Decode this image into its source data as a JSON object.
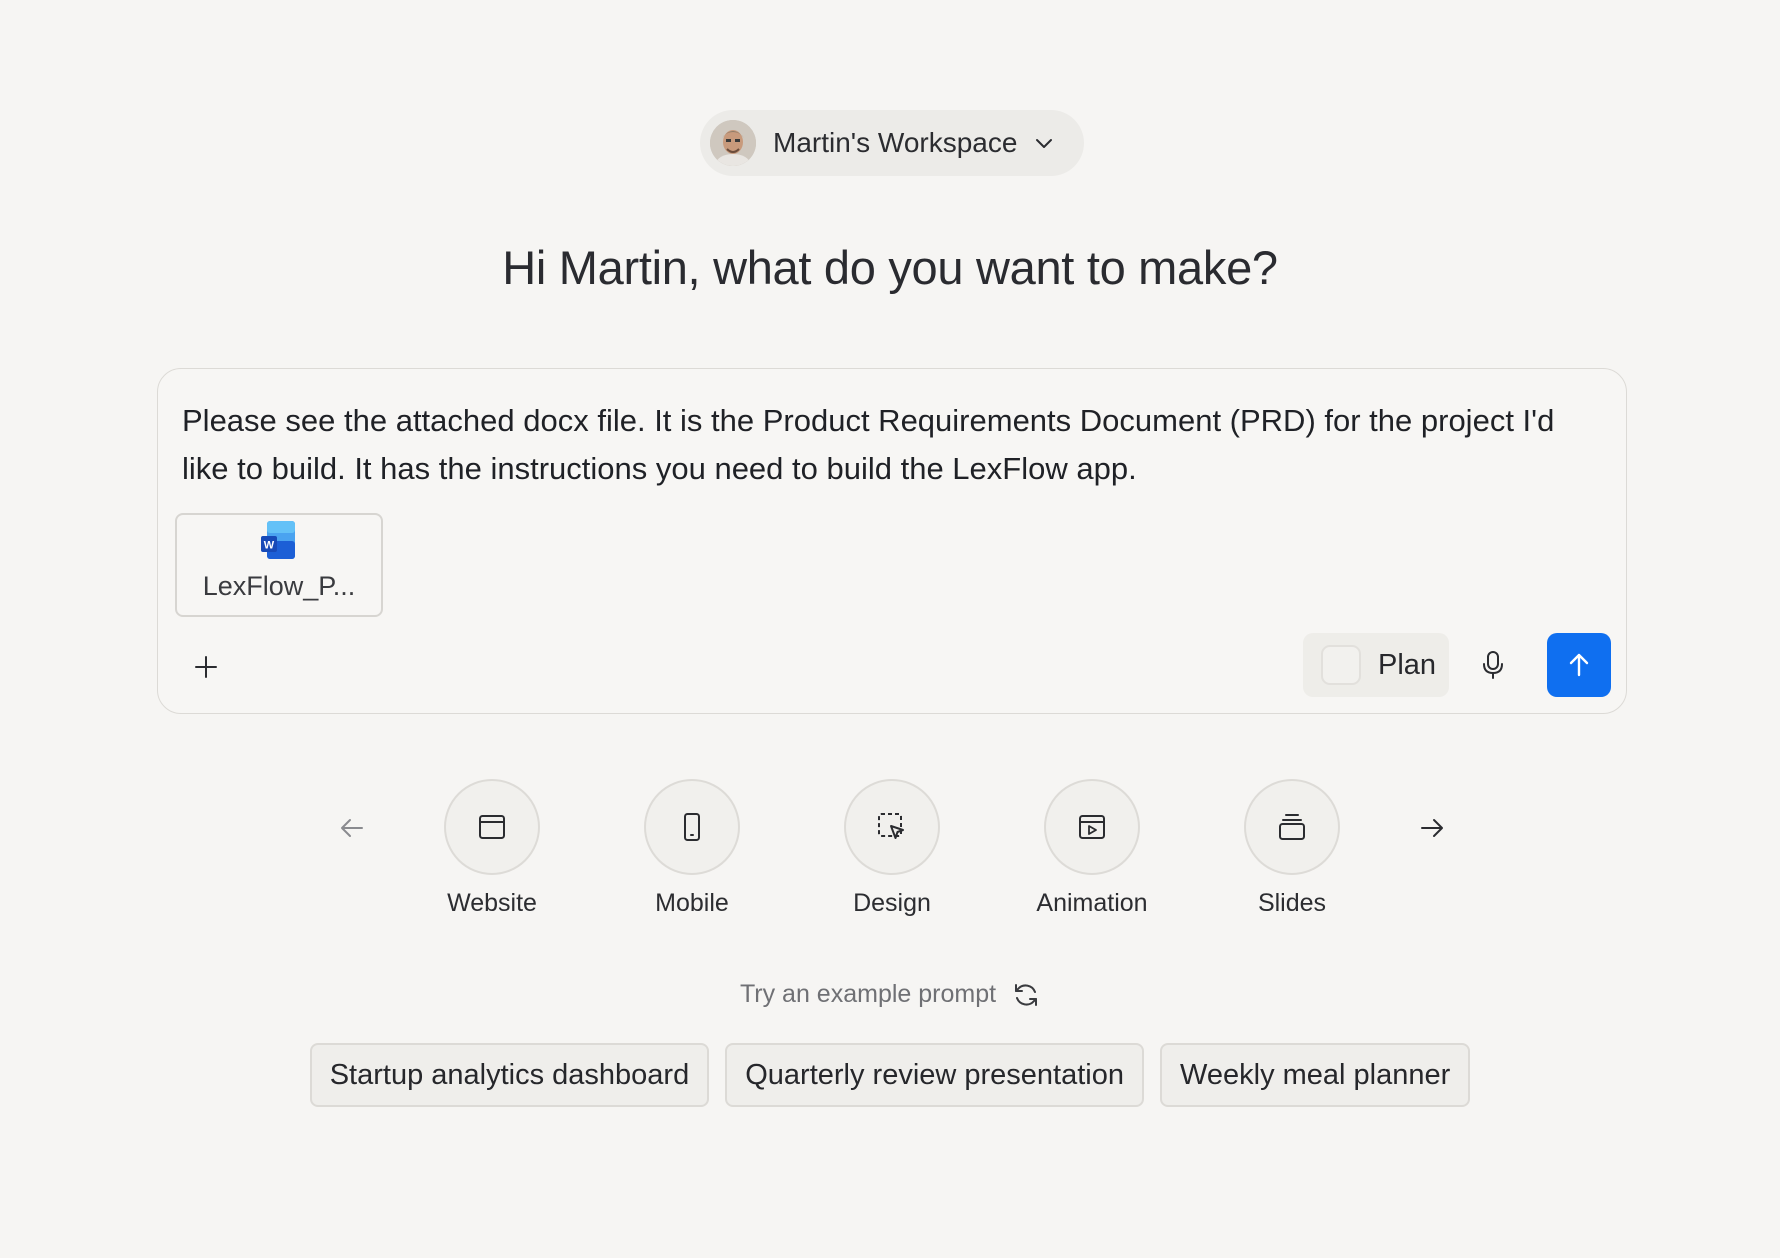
{
  "workspace": {
    "name": "Martin's Workspace"
  },
  "greeting": "Hi Martin, what do you want to make?",
  "prompt": {
    "text": "Please see the attached docx file. It is the Product Requirements Document (PRD) for the project I'd like to build. It has the instructions you need to build the LexFlow app.",
    "attachment": {
      "filename": "LexFlow_P...",
      "icon": "word-doc-icon"
    },
    "plan_label": "Plan",
    "send_color": "#0f6ff0"
  },
  "categories": [
    {
      "label": "Website",
      "icon": "browser-window-icon"
    },
    {
      "label": "Mobile",
      "icon": "phone-icon"
    },
    {
      "label": "Design",
      "icon": "dashed-select-cursor-icon"
    },
    {
      "label": "Animation",
      "icon": "play-frame-icon"
    },
    {
      "label": "Slides",
      "icon": "slides-stack-icon"
    }
  ],
  "examples": {
    "label": "Try an example prompt",
    "chips": [
      "Startup analytics dashboard",
      "Quarterly review presentation",
      "Weekly meal planner"
    ]
  }
}
